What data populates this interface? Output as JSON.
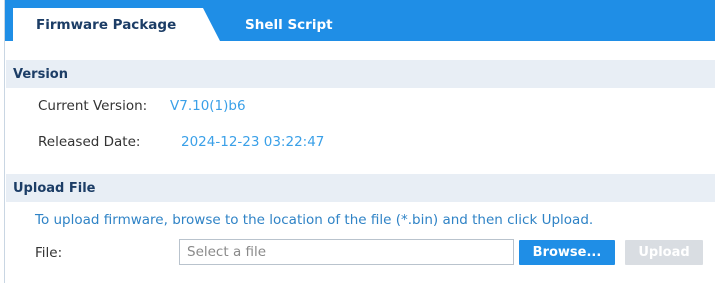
{
  "tabs": [
    {
      "label": "Firmware Package",
      "active": true
    },
    {
      "label": "Shell Script",
      "active": false
    }
  ],
  "version_section": {
    "title": "Version",
    "current_version_label": "Current Version:",
    "current_version_value": "V7.10(1)b6",
    "released_date_label": "Released Date:",
    "released_date_value": "2024-12-23 03:22:47"
  },
  "upload_section": {
    "title": "Upload File",
    "instructions": "To upload firmware, browse to the location of the file (*.bin) and then click Upload.",
    "file_label": "File:",
    "file_placeholder": "Select a file",
    "browse_label": "Browse...",
    "upload_label": "Upload"
  },
  "colors": {
    "accent": "#1f8ee6",
    "value_text": "#3aa0e8",
    "section_bg": "#e8eef5",
    "disabled_button": "#d9dde2"
  }
}
